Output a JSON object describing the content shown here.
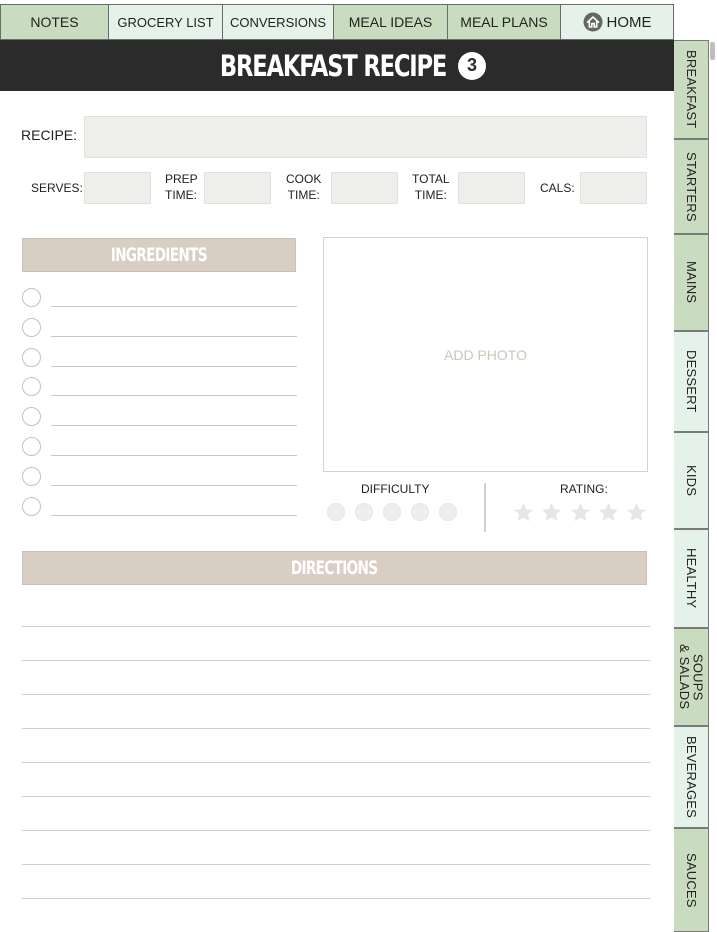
{
  "top_tabs": [
    {
      "label": "NOTES"
    },
    {
      "label": "GROCERY LIST"
    },
    {
      "label": "CONVERSIONS"
    },
    {
      "label": "MEAL IDEAS"
    },
    {
      "label": "MEAL PLANS"
    },
    {
      "label": "HOME",
      "icon": "home-icon"
    }
  ],
  "header": {
    "title": "BREAKFAST RECIPE",
    "badge": "3"
  },
  "side_tabs": [
    {
      "label": "BREAKFAST"
    },
    {
      "label": "STARTERS"
    },
    {
      "label": "MAINS"
    },
    {
      "label": "DESSERT"
    },
    {
      "label": "KIDS"
    },
    {
      "label": "HEALTHY"
    },
    {
      "label": "SOUPS\n& SALADS"
    },
    {
      "label": "BEVERAGES"
    },
    {
      "label": "SAUCES"
    }
  ],
  "form": {
    "recipe_label": "RECIPE:",
    "serves_label": "SERVES:",
    "prep_label_1": "PREP",
    "prep_label_2": "TIME:",
    "cook_label_1": "COOK",
    "cook_label_2": "TIME:",
    "total_label_1": "TOTAL",
    "total_label_2": "TIME:",
    "cals_label": "CALS:"
  },
  "ingredients": {
    "title": "INGREDIENTS",
    "rows": 8
  },
  "photo": {
    "label": "ADD PHOTO"
  },
  "difficulty": {
    "label": "DIFFICULTY",
    "dots": 5
  },
  "rating": {
    "label": "RATING:",
    "stars": 5
  },
  "directions": {
    "title": "DIRECTIONS",
    "lines": 9
  },
  "colors": {
    "tab_green": "#c9dcc0",
    "tab_light": "#e4f2e9",
    "header_dark": "#2b2b2b",
    "section_tan": "#d8cec4",
    "field_gray": "#eeeeea"
  }
}
